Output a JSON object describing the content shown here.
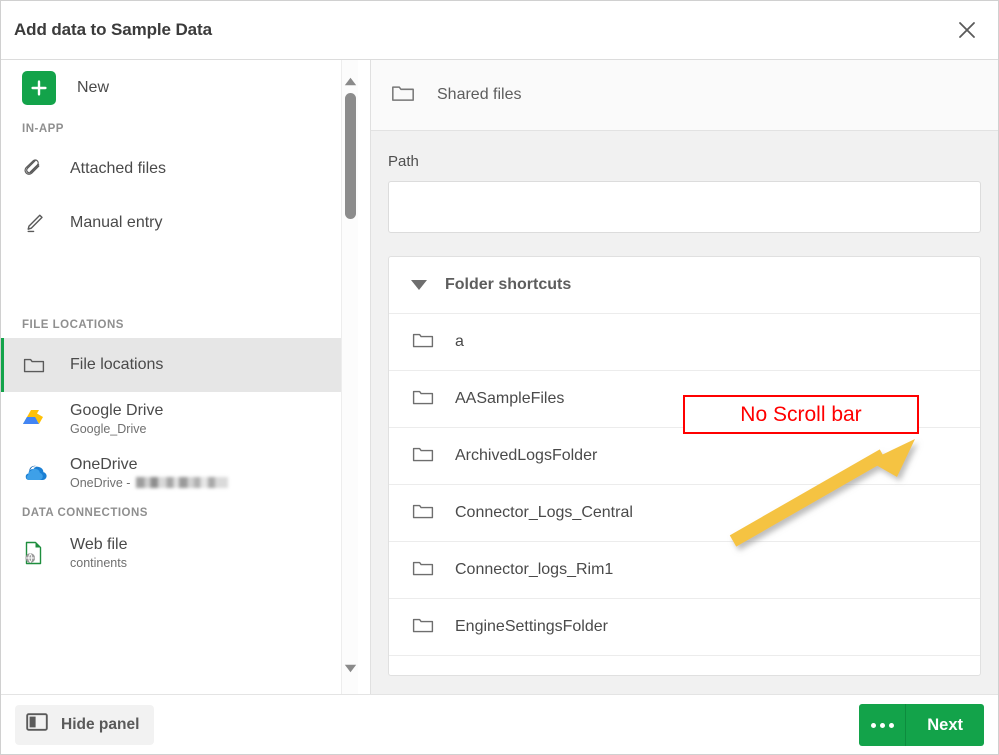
{
  "window": {
    "title": "Add data to Sample Data",
    "close_icon": "close-icon"
  },
  "sidebar": {
    "new": {
      "label": "New",
      "icon": "plus-icon"
    },
    "groups": [
      {
        "title": "IN-APP"
      },
      {
        "title": "FILE LOCATIONS"
      },
      {
        "title": "DATA CONNECTIONS"
      }
    ],
    "in_app_items": [
      {
        "label": "Attached files",
        "icon": "paperclip-icon"
      },
      {
        "label": "Manual entry",
        "icon": "pencil-icon"
      }
    ],
    "file_location_items": [
      {
        "label": "File locations",
        "sub": "",
        "icon": "folder-icon",
        "active": true
      },
      {
        "label": "Google Drive",
        "sub": "Google_Drive",
        "icon": "google-drive-icon",
        "active": false
      },
      {
        "label": "OneDrive",
        "sub": "OneDrive - ",
        "sub_redacted": true,
        "icon": "onedrive-icon",
        "active": false
      }
    ],
    "data_connection_items": [
      {
        "label": "Web file",
        "sub": "continents",
        "icon": "web-file-icon"
      }
    ],
    "scrollbar": {
      "up_icon": "triangle-up-icon",
      "down_icon": "triangle-down-icon",
      "thumb": "scrollbar-thumb"
    }
  },
  "panel": {
    "header": {
      "label": "Shared files",
      "icon": "folder-icon"
    },
    "path": {
      "label": "Path",
      "value": "",
      "placeholder": ""
    },
    "shortcuts": {
      "title": "Folder shortcuts",
      "caret_icon": "caret-down-icon",
      "folders": [
        {
          "name": "a"
        },
        {
          "name": "AASampleFiles"
        },
        {
          "name": "ArchivedLogsFolder"
        },
        {
          "name": "Connector_Logs_Central"
        },
        {
          "name": "Connector_logs_Rim1"
        },
        {
          "name": "EngineSettingsFolder"
        }
      ]
    }
  },
  "footer": {
    "hide_panel": {
      "label": "Hide panel",
      "icon": "panel-icon"
    },
    "more": {
      "label": "",
      "icon": "ellipsis-icon"
    },
    "next": {
      "label": "Next"
    }
  },
  "annotations": {
    "callout_text": "No Scroll bar",
    "callout_color": "#ff0000",
    "arrow_color": "#f5c342"
  }
}
